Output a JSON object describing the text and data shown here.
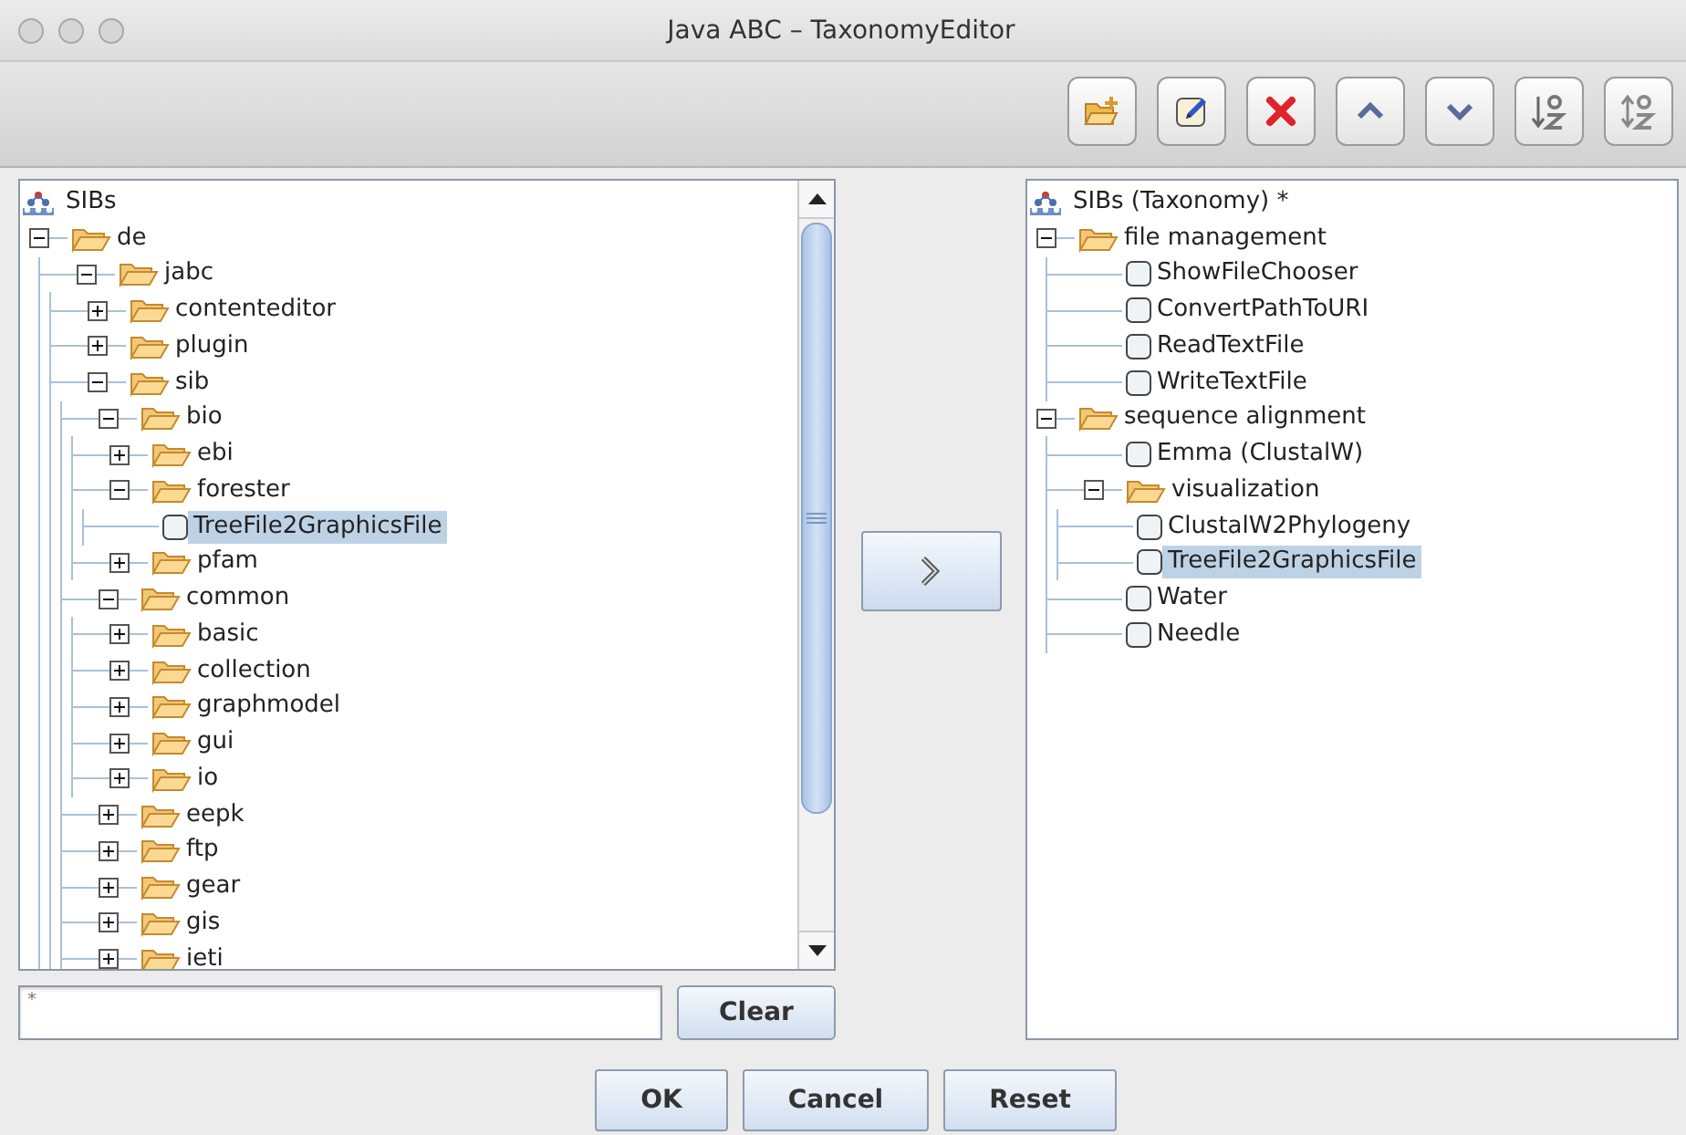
{
  "window": {
    "title": "Java ABC – TaxonomyEditor"
  },
  "toolbar": [
    {
      "kind": "new-folder"
    },
    {
      "kind": "edit"
    },
    {
      "kind": "delete"
    },
    {
      "kind": "move-up"
    },
    {
      "kind": "move-down"
    },
    {
      "kind": "sort-ascending"
    },
    {
      "kind": "sort-descending"
    }
  ],
  "source_tree": {
    "root": {
      "label": "SIBs",
      "children": [
        {
          "label": "de",
          "kind": "folder",
          "expanded": true,
          "selected": false,
          "children": [
            {
              "label": "jabc",
              "kind": "folder",
              "expanded": true,
              "selected": false,
              "children": [
                {
                  "label": "contenteditor",
                  "kind": "folder",
                  "expanded": false,
                  "selected": false
                },
                {
                  "label": "plugin",
                  "kind": "folder",
                  "expanded": false,
                  "selected": false
                },
                {
                  "label": "sib",
                  "kind": "folder",
                  "expanded": true,
                  "selected": false,
                  "children": [
                    {
                      "label": "bio",
                      "kind": "folder",
                      "expanded": true,
                      "selected": false,
                      "children": [
                        {
                          "label": "ebi",
                          "kind": "folder",
                          "expanded": false,
                          "selected": false
                        },
                        {
                          "label": "forester",
                          "kind": "folder",
                          "expanded": true,
                          "selected": false,
                          "children": [
                            {
                              "label": "TreeFile2GraphicsFile",
                              "kind": "item",
                              "checked": false,
                              "selected": true
                            }
                          ]
                        },
                        {
                          "label": "pfam",
                          "kind": "folder",
                          "expanded": false,
                          "selected": false
                        }
                      ]
                    },
                    {
                      "label": "common",
                      "kind": "folder",
                      "expanded": true,
                      "selected": false,
                      "children": [
                        {
                          "label": "basic",
                          "kind": "folder",
                          "expanded": false,
                          "selected": false
                        },
                        {
                          "label": "collection",
                          "kind": "folder",
                          "expanded": false,
                          "selected": false
                        },
                        {
                          "label": "graphmodel",
                          "kind": "folder",
                          "expanded": false,
                          "selected": false
                        },
                        {
                          "label": "gui",
                          "kind": "folder",
                          "expanded": false,
                          "selected": false
                        },
                        {
                          "label": "io",
                          "kind": "folder",
                          "expanded": false,
                          "selected": false
                        }
                      ]
                    },
                    {
                      "label": "eepk",
                      "kind": "folder",
                      "expanded": false,
                      "selected": false
                    },
                    {
                      "label": "ftp",
                      "kind": "folder",
                      "expanded": false,
                      "selected": false
                    },
                    {
                      "label": "gear",
                      "kind": "folder",
                      "expanded": false,
                      "selected": false
                    },
                    {
                      "label": "gis",
                      "kind": "folder",
                      "expanded": false,
                      "selected": false
                    },
                    {
                      "label": "ieti",
                      "kind": "folder",
                      "expanded": false,
                      "selected": false
                    }
                  ]
                }
              ]
            }
          ]
        }
      ]
    }
  },
  "filter": {
    "value": "*"
  },
  "clear_button": "Clear",
  "target_tree": {
    "root": {
      "label": "SIBs (Taxonomy) *",
      "children": [
        {
          "label": "file management",
          "kind": "folder",
          "expanded": true,
          "selected": false,
          "children": [
            {
              "label": "ShowFileChooser",
              "kind": "item",
              "checked": false,
              "selected": false
            },
            {
              "label": "ConvertPathToURI",
              "kind": "item",
              "checked": false,
              "selected": false
            },
            {
              "label": "ReadTextFile",
              "kind": "item",
              "checked": false,
              "selected": false
            },
            {
              "label": "WriteTextFile",
              "kind": "item",
              "checked": false,
              "selected": false
            }
          ]
        },
        {
          "label": "sequence alignment",
          "kind": "folder",
          "expanded": true,
          "selected": false,
          "children": [
            {
              "label": "Emma (ClustalW)",
              "kind": "item",
              "checked": false,
              "selected": false
            },
            {
              "label": "visualization",
              "kind": "folder",
              "expanded": true,
              "selected": false,
              "children": [
                {
                  "label": "ClustalW2Phylogeny",
                  "kind": "item",
                  "checked": false,
                  "selected": false
                },
                {
                  "label": "TreeFile2GraphicsFile",
                  "kind": "item",
                  "checked": false,
                  "selected": true
                }
              ]
            },
            {
              "label": "Water",
              "kind": "item",
              "checked": false,
              "selected": false
            },
            {
              "label": "Needle",
              "kind": "item",
              "checked": false,
              "selected": false
            }
          ]
        }
      ]
    }
  },
  "buttons": [
    "OK",
    "Cancel",
    "Reset"
  ]
}
